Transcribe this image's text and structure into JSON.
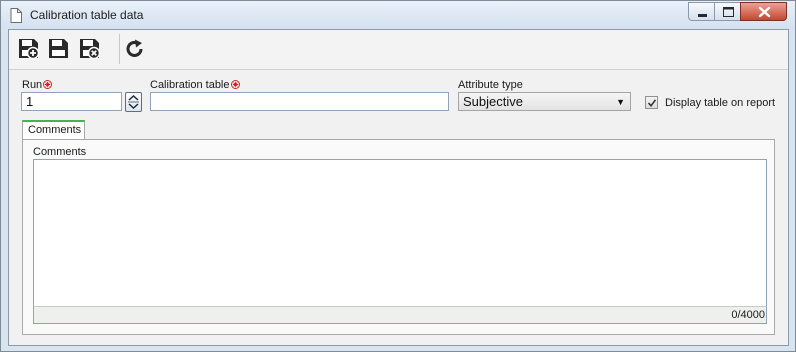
{
  "window": {
    "title": "Calibration table data",
    "title_icon": "document-icon",
    "controls": [
      "minimize-icon",
      "maximize-icon",
      "close-icon"
    ]
  },
  "toolbar": {
    "buttons": [
      {
        "name": "save-and-new",
        "icon": "floppy-plus-icon"
      },
      {
        "name": "save",
        "icon": "floppy-icon"
      },
      {
        "name": "save-and-close",
        "icon": "floppy-close-icon"
      },
      {
        "name": "refresh",
        "icon": "refresh-icon"
      }
    ]
  },
  "form": {
    "run": {
      "label": "Run",
      "value": "1",
      "required": true
    },
    "calibration_table": {
      "label": "Calibration table",
      "value": "",
      "required": true
    },
    "attribute_type": {
      "label": "Attribute type",
      "value": "Subjective"
    },
    "display_table": {
      "label": "Display table on report",
      "checked": true
    }
  },
  "tabs": [
    {
      "label": "Comments",
      "active": true
    }
  ],
  "comments": {
    "label": "Comments",
    "value": "",
    "counter": "0/4000"
  },
  "colors": {
    "required": "#cc2222",
    "tab_accent": "#4caf50",
    "input_border": "#8fa4bb"
  }
}
